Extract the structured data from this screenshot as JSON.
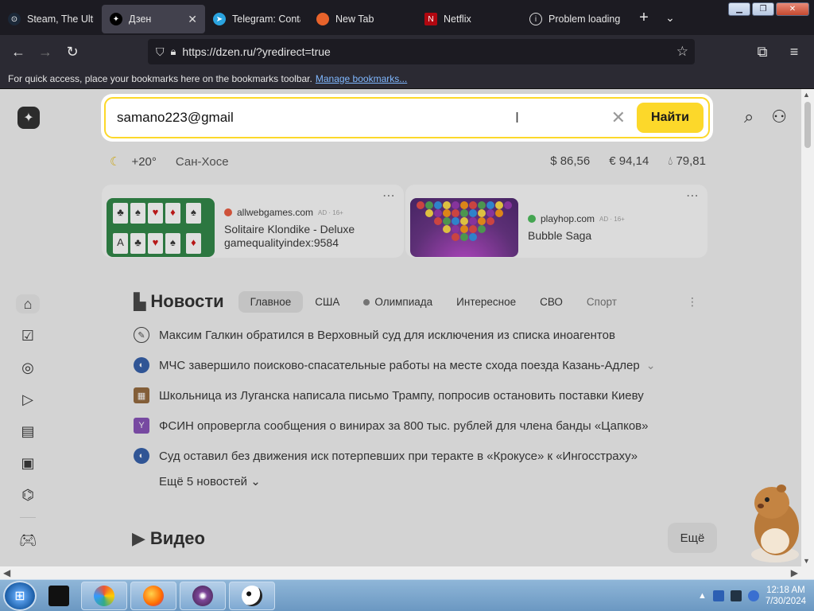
{
  "browser": {
    "tabs": [
      {
        "label": "Steam, The Ultin",
        "color": "#1b2838",
        "active": false
      },
      {
        "label": "Дзен",
        "color": "#1a1a1a",
        "active": true
      },
      {
        "label": "Telegram: Conta",
        "color": "#2aa3df",
        "active": false
      },
      {
        "label": "New Tab",
        "color": "#e8632b",
        "active": false
      },
      {
        "label": "Netflix",
        "color": "#b00710",
        "active": false
      },
      {
        "label": "Problem loading",
        "color": "#777777",
        "active": false
      }
    ],
    "url": "https://dzen.ru/?yredirect=true",
    "bookmarks_text": "For quick access, place your bookmarks here on the bookmarks toolbar.",
    "bookmarks_link": "Manage bookmarks..."
  },
  "search": {
    "value": "samano223@gmail",
    "button": "Найти"
  },
  "weather": {
    "temp": "+20°",
    "city": "Сан-Хосе"
  },
  "rates": {
    "usd": "$ 86,56",
    "eur": "€ 94,14",
    "oil": "79,81"
  },
  "ads": [
    {
      "source": "allwebgames.com",
      "tag": "AD · 16+",
      "title": "Solitaire Klondike - Deluxe",
      "subtitle": "gamequalityindex:9584"
    },
    {
      "source": "playhop.com",
      "tag": "AD · 16+",
      "title": "Bubble Saga",
      "subtitle": ""
    }
  ],
  "news": {
    "title": "Новости",
    "tabs": [
      "Главное",
      "США",
      "Олимпиада",
      "Интересное",
      "СВО",
      "Спорт"
    ],
    "items": [
      {
        "text": "Максим Галкин обратился в Верховный суд для исключения из списка иноагентов",
        "src_color": "#f0f0f0"
      },
      {
        "text": "МЧС завершило поисково-спасательные работы на месте схода поезда Казань-Адлер",
        "src_color": "#1f4fa0"
      },
      {
        "text": "Школьница из Луганска написала письмо Трампу, попросив остановить поставки Киеву",
        "src_color": "#8a5a2a"
      },
      {
        "text": "ФСИН опровергла сообщения о винирах за 800 тыс. рублей для члена банды «Цапков»",
        "src_color": "#7a3fb0"
      },
      {
        "text": "Суд оставил без движения иск потерпевших при теракте в «Крокусе» к «Ингосстраху»",
        "src_color": "#1f4fa0"
      }
    ],
    "more": "Ещё 5 новостей"
  },
  "video": {
    "title": "Видео",
    "more": "Ещё"
  },
  "taskbar": {
    "time": "12:18 AM",
    "date": "7/30/2024"
  }
}
